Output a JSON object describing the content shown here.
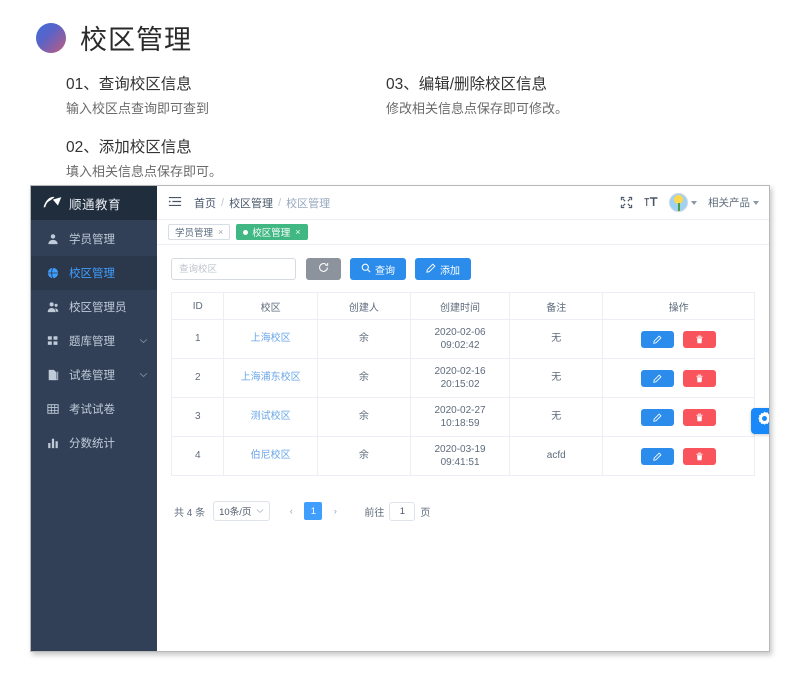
{
  "page": {
    "title": "校区管理",
    "sections": [
      {
        "heading": "01、查询校区信息",
        "desc": "输入校区点查询即可查到"
      },
      {
        "heading": "02、添加校区信息",
        "desc": "填入相关信息点保存即可。"
      },
      {
        "heading": "03、编辑/删除校区信息",
        "desc": "修改相关信息点保存即可修改。"
      }
    ]
  },
  "app": {
    "brand": {
      "name": "顺通教育",
      "logo_icon": "logo-icon"
    },
    "sidebar": {
      "items": [
        {
          "label": "学员管理",
          "icon": "user-icon",
          "active": false,
          "expandable": false
        },
        {
          "label": "校区管理",
          "icon": "globe-icon",
          "active": true,
          "expandable": false
        },
        {
          "label": "校区管理员",
          "icon": "user-group-icon",
          "active": false,
          "expandable": false
        },
        {
          "label": "题库管理",
          "icon": "grid-icon",
          "active": false,
          "expandable": true
        },
        {
          "label": "试卷管理",
          "icon": "copy-icon",
          "active": false,
          "expandable": true
        },
        {
          "label": "考试试卷",
          "icon": "table-icon",
          "active": false,
          "expandable": false
        },
        {
          "label": "分数统计",
          "icon": "bar-chart-icon",
          "active": false,
          "expandable": false
        }
      ]
    },
    "topbar": {
      "menu_icon": "hamburger-icon",
      "breadcrumb": [
        "首页",
        "校区管理",
        "校区管理"
      ],
      "fullscreen_icon": "fullscreen-icon",
      "font-size_icon": "text-size-icon",
      "avatar_icon": "avatar",
      "products_label": "相关产品"
    },
    "tabs": [
      {
        "label": "学员管理",
        "active": false,
        "closable": true
      },
      {
        "label": "校区管理",
        "active": true,
        "closable": true
      }
    ],
    "toolbar": {
      "search_placeholder": "查询校区",
      "search_value": "",
      "refresh_icon": "refresh-icon",
      "search_label": "查询",
      "add_label": "添加"
    },
    "table": {
      "columns": [
        "ID",
        "校区",
        "创建人",
        "创建时间",
        "备注",
        "操作"
      ],
      "rows": [
        {
          "id": "1",
          "campus": "上海校区",
          "creator": "余",
          "created": "2020-02-06 09:02:42",
          "remark": "无"
        },
        {
          "id": "2",
          "campus": "上海浦东校区",
          "creator": "余",
          "created": "2020-02-16 20:15:02",
          "remark": "无"
        },
        {
          "id": "3",
          "campus": "测试校区",
          "creator": "余",
          "created": "2020-02-27 10:18:59",
          "remark": "无"
        },
        {
          "id": "4",
          "campus": "伯尼校区",
          "creator": "余",
          "created": "2020-03-19 09:41:51",
          "remark": "acfd"
        }
      ],
      "row_actions": {
        "edit_icon": "edit-icon",
        "delete_icon": "trash-icon"
      }
    },
    "pagination": {
      "total_label": "共 4 条",
      "page_size": "10条/页",
      "prev_label": "‹",
      "next_label": "›",
      "current_page": "1",
      "goto_label": "前往",
      "goto_value": "1",
      "page_unit": "页"
    },
    "fab": {
      "icon": "settings-gear-icon"
    }
  },
  "colors": {
    "accent_blue": "#2b8ceb",
    "active_blue": "#409eff",
    "tab_green": "#41b883",
    "danger_red": "#f9535b",
    "sidebar_bg": "#324057",
    "sidebar_header_bg": "#1f2d3d"
  }
}
